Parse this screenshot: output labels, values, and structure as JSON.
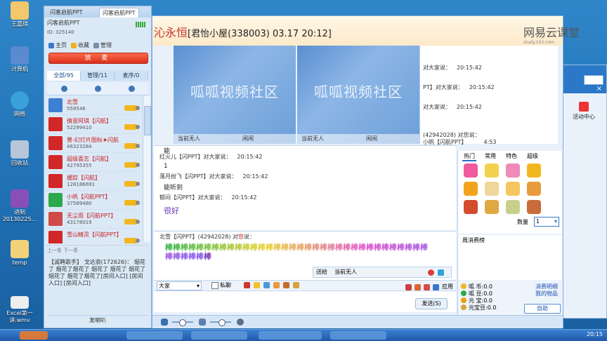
{
  "desktop": {
    "icons": [
      {
        "label": "王嘉琪"
      },
      {
        "label": "计算机"
      },
      {
        "label": "网络"
      },
      {
        "label": "回收站"
      },
      {
        "label": "进制 20130225..."
      },
      {
        "label": "temp"
      },
      {
        "label": "Excel第一讲.wmv"
      }
    ],
    "taskbar_time": "20:15"
  },
  "qq": {
    "tabs": [
      "闪客启航PPT",
      "闪客启航PPT"
    ],
    "title": "闪客启航PPT",
    "id": "ID: 325140",
    "nav": {
      "home": "主页",
      "fav": "收藏",
      "manage": "管理"
    },
    "play_label": "放 麦",
    "seg": {
      "all": "全部/95",
      "admin": "管理/11",
      "order": "麦序/0"
    },
    "users": [
      {
        "name": "北雪",
        "id": "559546",
        "avatar_color": "#3d7fd2"
      },
      {
        "name": "倩意阿琪【闪航】",
        "id": "52299410",
        "avatar_color": "#d22727"
      },
      {
        "name": "曾-幻灯片图标★闪航",
        "id": "46323284",
        "avatar_color": "#d22727"
      },
      {
        "name": "超级喜志【闪航】",
        "id": "42795355",
        "avatar_color": "#d22727"
      },
      {
        "name": "缓踪【闪航】",
        "id": "128186691",
        "avatar_color": "#d22727"
      },
      {
        "name": "小帆【闪航PPT】",
        "id": "37589480",
        "avatar_color": "#2da84a"
      },
      {
        "name": "无尘雨【闪航PPT】",
        "id": "43178019",
        "avatar_color": "#d04a4a"
      },
      {
        "name": "雪山精灵【闪航PPT】",
        "id": "",
        "avatar_color": "#d22727"
      }
    ],
    "announcement_hint": "上一条 下一条",
    "announcement": "【诚聘歌手】 戈达浪(172626)： 烟花了 烟花了烟花了 烟花了 烟花了 烟花了烟花了 烟花了烟花了[房间入口] [房间入口] [房间入口]",
    "footer": "发喇叭"
  },
  "main": {
    "title_left": "沁永恒",
    "title_room": "[君怡小屋(338003) 03.17 20:12]",
    "brand": "网易云课堂",
    "brand_sub": "study.163.com",
    "videos": [
      {
        "caption": "呱呱视频社区",
        "status": "当前无人",
        "audience": "闲闲"
      },
      {
        "caption": "呱呱视频社区",
        "status": "当前无人",
        "audience": "闲闲"
      }
    ],
    "public_chat": [
      {
        "text": "对大家说：",
        "time": "20:15:42"
      },
      {
        "text": "PT】对大家说：",
        "time": "20:15:42"
      },
      {
        "text": "对大家说：",
        "time": "20:15:42"
      },
      {
        "text": "(42942028) 对您说：",
        "time": ""
      },
      {
        "text": "小帆【闪航PPT】",
        "time": "4:53"
      }
    ],
    "messages": [
      {
        "name": "红火儿【闪PPT】",
        "action": "对大家说：",
        "time": "20:15:42",
        "body": "能"
      },
      {
        "name": "",
        "action": "",
        "time": "",
        "body": "1"
      },
      {
        "name": "落月纷飞【闪PPT】",
        "action": "对大家说：",
        "time": "20:15:42",
        "body": "能听到"
      },
      {
        "name": "郁闷【闪PPT】",
        "action": "对大家说：",
        "time": "20:15:42",
        "body": "很好"
      }
    ],
    "private_msg": {
      "name": "北雪【闪PPT】(42942028) 对",
      "to": "您",
      "suffix": "说：",
      "body": "棒棒棒棒棒棒棒棒棒棒棒棒棒棒棒棒棒棒棒棒棒棒棒棒棒棒棒棒棒棒棒棒棒棒棒棒棒棒棒",
      "body2": "棒"
    },
    "sendbar": {
      "label": "送给",
      "target": "当前无人"
    },
    "toolbar": {
      "to": "大家",
      "private": "私聊",
      "apply": "应用"
    },
    "send_label": "发送(S)",
    "gift_tabs": [
      "热门",
      "常用",
      "特色",
      "超级"
    ],
    "qty_label": "数量",
    "qty_value": "1",
    "weekly_tab": "周消费榜",
    "wallet": [
      {
        "name": "呱  币:0.0",
        "color": "#f2b71e"
      },
      {
        "name": "呱  豆:0.0",
        "color": "#2da84a"
      },
      {
        "name": "元  宝:0.0",
        "color": "#e8a10d"
      },
      {
        "name": "元宝豆:0.0",
        "color": "#d8a23b"
      }
    ],
    "wallet_links": [
      "消费明细",
      "我的物品"
    ],
    "help_label": "自助"
  },
  "bgwin": {
    "activity": "活动中心"
  }
}
